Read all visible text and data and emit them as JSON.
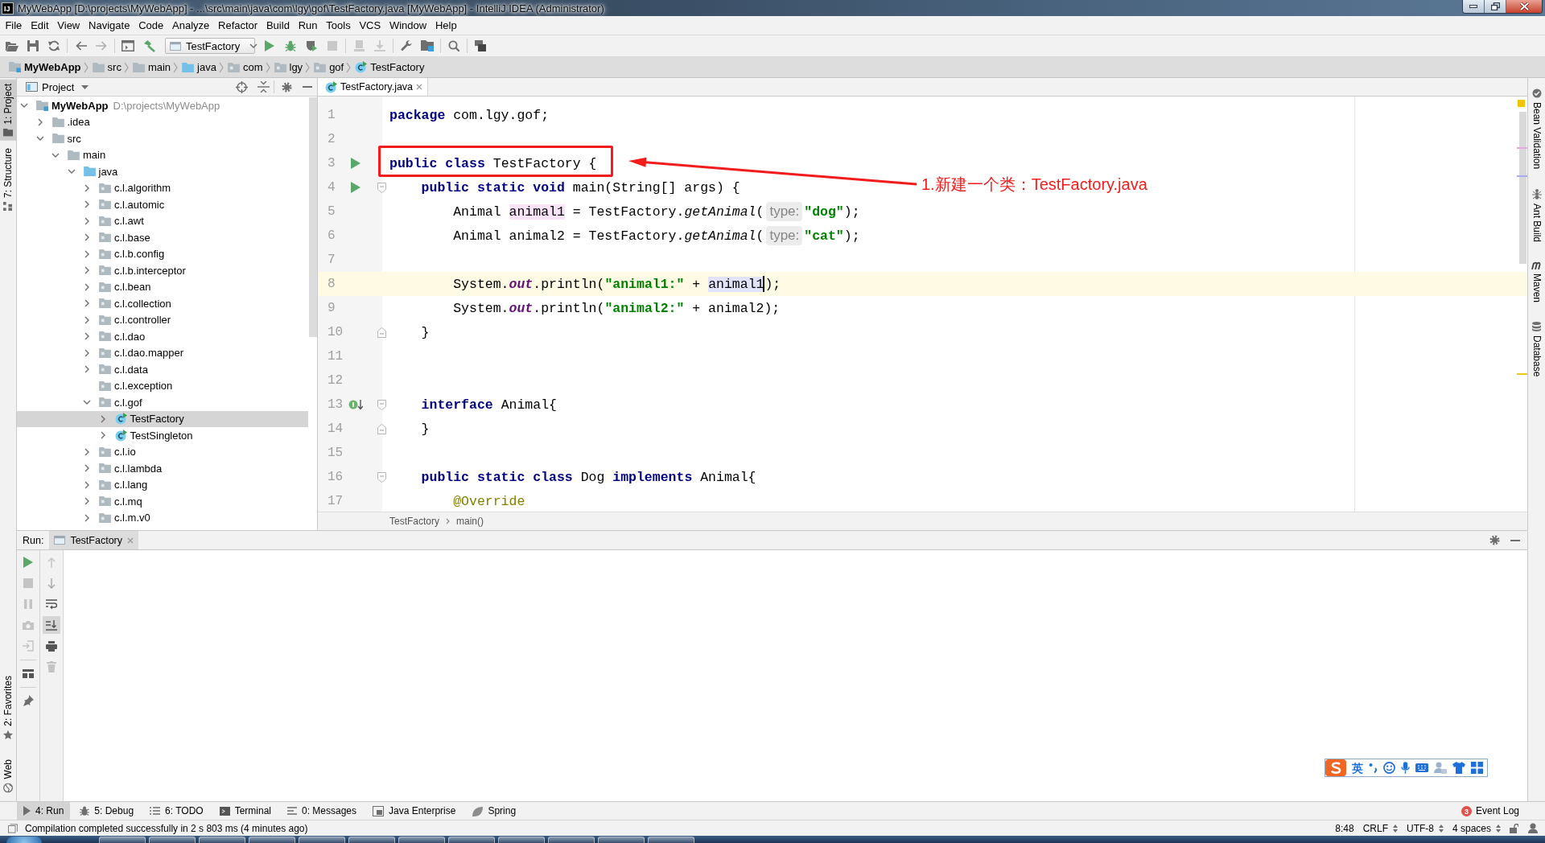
{
  "window": {
    "logo_text": "IJ",
    "title": "MyWebApp [D:\\projects\\MyWebApp] - ...\\src\\main\\java\\com\\lgy\\gof\\TestFactory.java [MyWebApp] - IntelliJ IDEA (Administrator)"
  },
  "menu": [
    "File",
    "Edit",
    "View",
    "Navigate",
    "Code",
    "Analyze",
    "Refactor",
    "Build",
    "Run",
    "Tools",
    "VCS",
    "Window",
    "Help"
  ],
  "toolbar": {
    "run_config": "TestFactory"
  },
  "navigation": [
    {
      "label": "MyWebApp",
      "kind": "module"
    },
    {
      "label": "src",
      "kind": "folder"
    },
    {
      "label": "main",
      "kind": "folder"
    },
    {
      "label": "java",
      "kind": "source-folder"
    },
    {
      "label": "com",
      "kind": "package"
    },
    {
      "label": "lgy",
      "kind": "package"
    },
    {
      "label": "gof",
      "kind": "package"
    },
    {
      "label": "TestFactory",
      "kind": "class"
    }
  ],
  "left_strip_top": [
    {
      "label": "1: Project",
      "selected": true
    },
    {
      "label": "7: Structure",
      "selected": false
    }
  ],
  "left_strip_bottom": [
    {
      "label": "2: Favorites",
      "selected": false
    },
    {
      "label": "Web",
      "selected": false
    }
  ],
  "right_strip": [
    {
      "label": "Bean Validation",
      "selected": false
    },
    {
      "label": "Ant Build",
      "selected": false
    },
    {
      "label": "Maven",
      "selected": false
    },
    {
      "label": "Database",
      "selected": false
    }
  ],
  "project_panel": {
    "title": "Project",
    "tree": [
      {
        "label": "MyWebApp",
        "kind": "module",
        "path": "D:\\projects\\MyWebApp",
        "expanded": true,
        "selected": false,
        "children": [
          {
            "label": ".idea",
            "kind": "folder",
            "expanded": false,
            "selected": false
          },
          {
            "label": "src",
            "kind": "folder",
            "expanded": true,
            "selected": false,
            "children": [
              {
                "label": "main",
                "kind": "folder",
                "expanded": true,
                "selected": false,
                "children": [
                  {
                    "label": "java",
                    "kind": "source-folder",
                    "expanded": true,
                    "selected": false,
                    "children": [
                      {
                        "label": "c.l.algorithm",
                        "kind": "package",
                        "expanded": false,
                        "selected": false
                      },
                      {
                        "label": "c.l.automic",
                        "kind": "package",
                        "expanded": false,
                        "selected": false
                      },
                      {
                        "label": "c.l.awt",
                        "kind": "package",
                        "expanded": false,
                        "selected": false
                      },
                      {
                        "label": "c.l.base",
                        "kind": "package",
                        "expanded": false,
                        "selected": false
                      },
                      {
                        "label": "c.l.b.config",
                        "kind": "package",
                        "expanded": false,
                        "selected": false
                      },
                      {
                        "label": "c.l.b.interceptor",
                        "kind": "package",
                        "expanded": false,
                        "selected": false
                      },
                      {
                        "label": "c.l.bean",
                        "kind": "package",
                        "expanded": false,
                        "selected": false
                      },
                      {
                        "label": "c.l.collection",
                        "kind": "package",
                        "expanded": false,
                        "selected": false
                      },
                      {
                        "label": "c.l.controller",
                        "kind": "package",
                        "expanded": false,
                        "selected": false
                      },
                      {
                        "label": "c.l.dao",
                        "kind": "package",
                        "expanded": false,
                        "selected": false
                      },
                      {
                        "label": "c.l.dao.mapper",
                        "kind": "package",
                        "expanded": false,
                        "selected": false
                      },
                      {
                        "label": "c.l.data",
                        "kind": "package",
                        "expanded": false,
                        "selected": false
                      },
                      {
                        "label": "c.l.exception",
                        "kind": "package",
                        "selected": false
                      },
                      {
                        "label": "c.l.gof",
                        "kind": "package",
                        "expanded": true,
                        "selected": false,
                        "children": [
                          {
                            "label": "TestFactory",
                            "kind": "class",
                            "expanded": false,
                            "selected": true
                          },
                          {
                            "label": "TestSingleton",
                            "kind": "class",
                            "expanded": false,
                            "selected": false
                          }
                        ]
                      },
                      {
                        "label": "c.l.io",
                        "kind": "package",
                        "expanded": false,
                        "selected": false
                      },
                      {
                        "label": "c.l.lambda",
                        "kind": "package",
                        "expanded": false,
                        "selected": false
                      },
                      {
                        "label": "c.l.lang",
                        "kind": "package",
                        "expanded": false,
                        "selected": false
                      },
                      {
                        "label": "c.l.mq",
                        "kind": "package",
                        "expanded": false,
                        "selected": false
                      },
                      {
                        "label": "c.l.m.v0",
                        "kind": "package",
                        "expanded": false,
                        "selected": false
                      }
                    ]
                  }
                ]
              }
            ]
          }
        ]
      }
    ]
  },
  "editor": {
    "tabs": [
      {
        "label": "TestFactory.java",
        "selected": true
      }
    ],
    "lines": [
      {
        "number": "1",
        "current": false,
        "tokens": [
          {
            "text": "package",
            "kind": "keyword"
          },
          {
            "text": " com.lgy.gof;",
            "kind": "plain"
          }
        ]
      },
      {
        "number": "2",
        "current": false
      },
      {
        "number": "3",
        "current": false,
        "markers": [
          {
            "kind": "run"
          }
        ],
        "tokens": [
          {
            "text": "public class",
            "kind": "keyword"
          },
          {
            "text": " TestFactory {",
            "kind": "plain"
          }
        ],
        "callout": "1.新建一个类：TestFactory.java"
      },
      {
        "number": "4",
        "current": false,
        "markers": [
          {
            "kind": "run"
          },
          {
            "kind": "fold-start"
          }
        ],
        "tokens": [
          {
            "text": "    public static void",
            "kind": "keyword"
          },
          {
            "text": " main(String[] args) {",
            "kind": "plain"
          }
        ]
      },
      {
        "number": "5",
        "current": false,
        "tokens": [
          {
            "text": "        Animal ",
            "kind": "plain"
          },
          {
            "text": "animal1",
            "kind": "write-usage"
          },
          {
            "text": " = TestFactory.",
            "kind": "plain"
          },
          {
            "text": "getAnimal",
            "kind": "static-method"
          },
          {
            "text": "(",
            "kind": "plain"
          },
          {
            "text": "type:",
            "kind": "hint"
          },
          {
            "text": "\"dog\"",
            "kind": "string"
          },
          {
            "text": ");",
            "kind": "plain"
          }
        ]
      },
      {
        "number": "6",
        "current": false,
        "tokens": [
          {
            "text": "        Animal animal2 = TestFactory.",
            "kind": "plain"
          },
          {
            "text": "getAnimal",
            "kind": "static-method"
          },
          {
            "text": "(",
            "kind": "plain"
          },
          {
            "text": "type:",
            "kind": "hint"
          },
          {
            "text": "\"cat\"",
            "kind": "string"
          },
          {
            "text": ");",
            "kind": "plain"
          }
        ]
      },
      {
        "number": "7",
        "current": false
      },
      {
        "number": "8",
        "current": true,
        "tokens": [
          {
            "text": "        System.",
            "kind": "plain"
          },
          {
            "text": "out",
            "kind": "static-field"
          },
          {
            "text": ".println(",
            "kind": "plain"
          },
          {
            "text": "\"animal1:\"",
            "kind": "string"
          },
          {
            "text": " + ",
            "kind": "plain"
          },
          {
            "text": "animal1",
            "kind": "read-usage",
            "caret": true
          },
          {
            "text": ");",
            "kind": "plain"
          }
        ]
      },
      {
        "number": "9",
        "current": false,
        "tokens": [
          {
            "text": "        System.",
            "kind": "plain"
          },
          {
            "text": "out",
            "kind": "static-field"
          },
          {
            "text": ".println(",
            "kind": "plain"
          },
          {
            "text": "\"animal2:\"",
            "kind": "string"
          },
          {
            "text": " + animal2);",
            "kind": "plain"
          }
        ]
      },
      {
        "number": "10",
        "current": false,
        "markers": [
          {
            "kind": "fold-end"
          }
        ],
        "tokens": [
          {
            "text": "    }",
            "kind": "plain"
          }
        ]
      },
      {
        "number": "11",
        "current": false
      },
      {
        "number": "12",
        "current": false
      },
      {
        "number": "13",
        "current": false,
        "markers": [
          {
            "kind": "implemented"
          },
          {
            "kind": "fold-start"
          }
        ],
        "tokens": [
          {
            "text": "    interface",
            "kind": "keyword"
          },
          {
            "text": " Animal{",
            "kind": "plain"
          }
        ]
      },
      {
        "number": "14",
        "current": false,
        "markers": [
          {
            "kind": "fold-end"
          }
        ],
        "tokens": [
          {
            "text": "    }",
            "kind": "plain"
          }
        ]
      },
      {
        "number": "15",
        "current": false
      },
      {
        "number": "16",
        "current": false,
        "markers": [
          {
            "kind": "fold-start"
          }
        ],
        "tokens": [
          {
            "text": "    public static class",
            "kind": "keyword"
          },
          {
            "text": " Dog ",
            "kind": "plain"
          },
          {
            "text": "implements",
            "kind": "keyword"
          },
          {
            "text": " Animal{",
            "kind": "plain"
          }
        ]
      },
      {
        "number": "17",
        "current": false,
        "tokens": [
          {
            "text": "        @Override",
            "kind": "annotation"
          }
        ]
      }
    ],
    "breadcrumbs": [
      "TestFactory",
      "main()"
    ]
  },
  "run_panel": {
    "title": "Run:",
    "tabs": [
      {
        "label": "TestFactory",
        "selected": true
      }
    ],
    "soft_wrap": false,
    "scroll_to_end": true
  },
  "bottom_bar": {
    "tools": [
      {
        "label": "4: Run",
        "selected": true
      },
      {
        "label": "5: Debug",
        "selected": false
      },
      {
        "label": "6: TODO",
        "selected": false
      },
      {
        "label": "Terminal",
        "selected": false
      },
      {
        "label": "0: Messages",
        "selected": false
      },
      {
        "label": "Java Enterprise",
        "selected": false
      },
      {
        "label": "Spring",
        "selected": false
      }
    ],
    "event_log": {
      "label": "Event Log",
      "count": "3"
    }
  },
  "status_bar": {
    "message": "Compilation completed successfully in 2 s 803 ms (4 minutes ago)",
    "position": "8:48",
    "line_separator": "CRLF",
    "encoding": "UTF-8",
    "indent": "4 spaces"
  },
  "ime_toolbar": {
    "mode": "英"
  }
}
